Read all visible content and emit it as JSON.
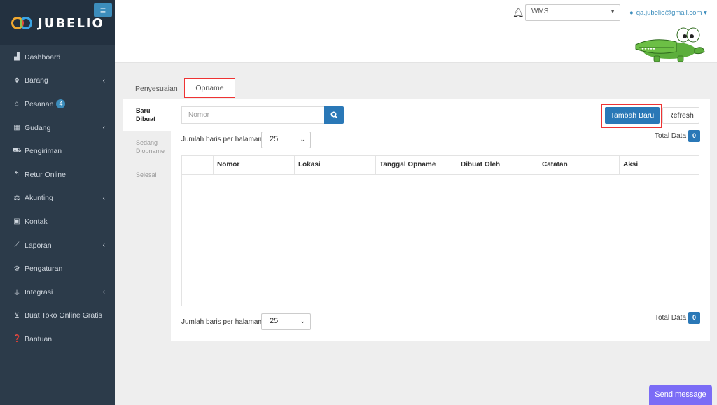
{
  "brand": {
    "name": "JUBELIO"
  },
  "sidebar": {
    "toggle_icon": "menu-icon",
    "items": [
      {
        "label": "Dashboard",
        "icon": "chart-area-icon"
      },
      {
        "label": "Barang",
        "icon": "cubes-icon",
        "has_submenu": true
      },
      {
        "label": "Pesanan",
        "icon": "basket-icon",
        "badge": "4"
      },
      {
        "label": "Gudang",
        "icon": "building-icon",
        "has_submenu": true
      },
      {
        "label": "Pengiriman",
        "icon": "truck-icon"
      },
      {
        "label": "Retur Online",
        "icon": "reply-icon"
      },
      {
        "label": "Akunting",
        "icon": "balance-scale-icon",
        "has_submenu": true
      },
      {
        "label": "Kontak",
        "icon": "address-card-icon"
      },
      {
        "label": "Laporan",
        "icon": "line-chart-icon",
        "has_submenu": true
      },
      {
        "label": "Pengaturan",
        "icon": "cogs-icon"
      },
      {
        "label": "Integrasi",
        "icon": "plug-icon",
        "has_submenu": true
      },
      {
        "label": "Buat Toko Online Gratis",
        "icon": "cart-icon"
      },
      {
        "label": "Bantuan",
        "icon": "question-circle-icon"
      }
    ]
  },
  "topbar": {
    "warehouse": "WMS",
    "user_email": "qa.jubelio@gmail.com"
  },
  "tabs": {
    "penyesuaian": "Penyesuaian",
    "opname": "Opname"
  },
  "subnav": {
    "baru_dibuat": "Baru Dibuat",
    "sedang_diopname": "Sedang Diopname",
    "selesai": "Selesai"
  },
  "search": {
    "placeholder": "Nomor"
  },
  "buttons": {
    "add": "Tambah Baru",
    "refresh": "Refresh"
  },
  "pagination": {
    "rows_label": "Jumlah baris per halaman",
    "rows_value": "25"
  },
  "total": {
    "label": "Total Data",
    "count": "0"
  },
  "table": {
    "columns": [
      "Nomor",
      "Lokasi",
      "Tanggal Opname",
      "Dibuat Oleh",
      "Catatan",
      "Aksi"
    ],
    "rows": []
  },
  "chat": {
    "label": "Send message"
  },
  "colors": {
    "primary": "#2a78b7",
    "sidebar": "#2c3b4a",
    "highlight": "#e33333",
    "chat": "#7b6cf6"
  }
}
